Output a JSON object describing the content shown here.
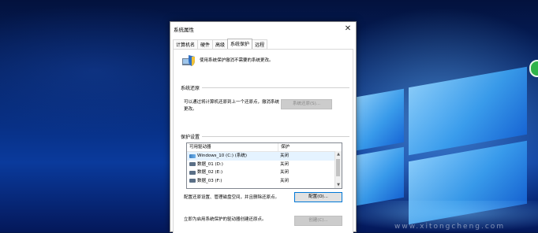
{
  "dialog": {
    "title": "系统属性",
    "close_symbol": "✕",
    "tabs": [
      {
        "label": "计算机名"
      },
      {
        "label": "硬件"
      },
      {
        "label": "高级"
      },
      {
        "label": "系统保护",
        "active": true
      },
      {
        "label": "远程"
      }
    ],
    "intro_text": "使用系统保护撤消不需要的系统更改。",
    "restore_group": {
      "label": "系统还原",
      "description": "可以通过将计算机还原到上一个还原点，撤消系统更改。",
      "button_label": "系统还原(S)..."
    },
    "protection_group": {
      "label": "保护设置",
      "columns": [
        "可用驱动器",
        "保护"
      ],
      "drives": [
        {
          "name": "Windows_10 (C:) (系统)",
          "status": "关闭",
          "icon": "system-drive-icon",
          "selected": true
        },
        {
          "name": "数据_01 (D:)",
          "status": "关闭",
          "icon": "drive-icon"
        },
        {
          "name": "数据_02 (E:)",
          "status": "关闭",
          "icon": "drive-icon"
        },
        {
          "name": "数据_03 (F:)",
          "status": "关闭",
          "icon": "drive-icon"
        }
      ],
      "config_text": "配置还原设置、管理磁盘空间，并且删除还原点。",
      "config_button": "配置(O)...",
      "create_text": "立即为启用系统保护的驱动器创建还原点。",
      "create_button": "创建(C)..."
    }
  },
  "desktop": {
    "watermark": "www.xitongcheng.com",
    "colors": {
      "wallpaper": "#062a78",
      "badge": "#2fb34a",
      "accent": "#0078d7"
    }
  }
}
